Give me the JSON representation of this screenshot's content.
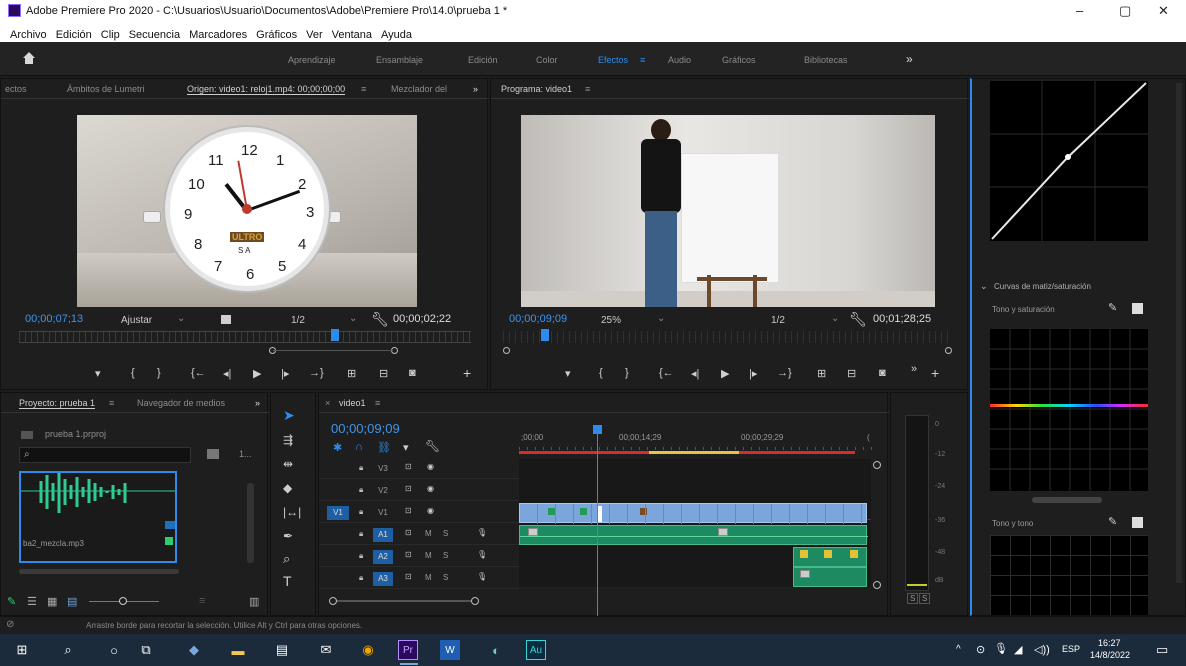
{
  "window": {
    "title": "Adobe Premiere Pro 2020 - C:\\Usuarios\\Usuario\\Documentos\\Adobe\\Premiere Pro\\14.0\\prueba 1 *",
    "controls": [
      "–",
      "▢",
      "✕"
    ]
  },
  "menu": [
    "Archivo",
    "Edición",
    "Clip",
    "Secuencia",
    "Marcadores",
    "Gráficos",
    "Ver",
    "Ventana",
    "Ayuda"
  ],
  "workspaces": {
    "items": [
      "Aprendizaje",
      "Ensamblaje",
      "Edición",
      "Color",
      "Efectos",
      "Audio",
      "Gráficos",
      "Bibliotecas"
    ],
    "active": "Efectos",
    "active_menu": "≡",
    "more": "»"
  },
  "source_panel": {
    "tabs": [
      "ectos",
      "Ámbitos de Lumetri",
      "Origen: video1: reloj1.mp4: 00;00;00;00",
      "≡",
      "Mezclador del",
      "»"
    ],
    "timecode_in": "00;00;07;13",
    "fit_label": "Ajustar",
    "resolution": "1/2",
    "duration": "00;00;02;22",
    "clock_numbers": [
      "12",
      "1",
      "2",
      "3",
      "4",
      "5",
      "6",
      "7",
      "8",
      "9",
      "10",
      "11"
    ],
    "clock_brand": "ULTRO",
    "clock_sub": "S A"
  },
  "program_panel": {
    "title": "Programa: video1",
    "menu": "≡",
    "timecode": "00;00;09;09",
    "zoom": "25%",
    "resolution": "1/2",
    "duration": "00;01;28;25"
  },
  "lumetri": {
    "section_label": "Curvas de matiz/saturación",
    "curve1_label": "Tono y saturación",
    "curve2_label": "Tono y tono"
  },
  "project_panel": {
    "tabs": [
      "Proyecto: prueba 1",
      "≡",
      "Navegador de medios",
      "»"
    ],
    "file": "prueba 1.prproj",
    "search_placeholder": "",
    "count": "1...",
    "item_name": "ba2_mezcla.mp3"
  },
  "timeline": {
    "title": "video1",
    "menu": "≡",
    "close": "×",
    "timecode": "00;00;09;09",
    "ruler": [
      ";00;00",
      "00;00;14;29",
      "00;00;29;29"
    ],
    "playhead_fraction": 0.22,
    "tracks": [
      {
        "target": "",
        "name": "V3",
        "type": "video"
      },
      {
        "target": "",
        "name": "V2",
        "type": "video"
      },
      {
        "target": "V1",
        "name": "V1",
        "type": "video"
      },
      {
        "target": "",
        "name": "A1",
        "type": "audio"
      },
      {
        "target": "",
        "name": "A2",
        "type": "audio"
      },
      {
        "target": "",
        "name": "A3",
        "type": "audio"
      }
    ],
    "audio_flags": [
      "M",
      "S"
    ],
    "meter_scale": [
      "0",
      "-12",
      "-24",
      "-36",
      "-48",
      "dB"
    ],
    "meter_buttons": [
      "S",
      "S"
    ]
  },
  "status": {
    "message": "Arrastre borde para recortar la selección. Utilice Alt y Ctrl para otras opciones."
  },
  "taskbar": {
    "lang": "ESP",
    "time": "16:27",
    "date": "14/8/2022",
    "apps": [
      "Pr",
      "Au"
    ]
  }
}
